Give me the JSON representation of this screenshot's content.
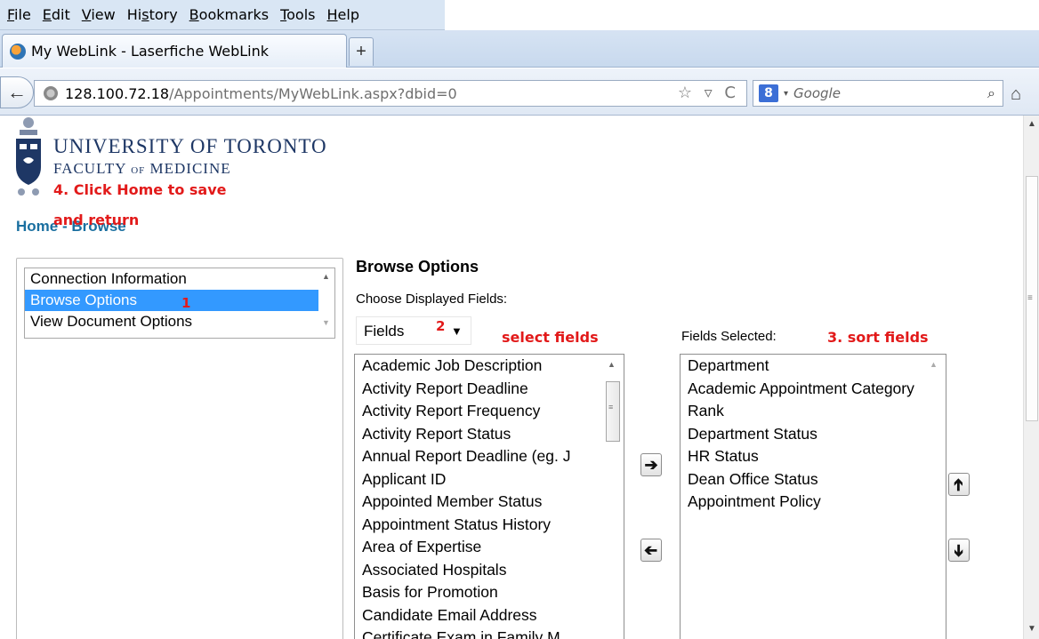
{
  "browser": {
    "menu": [
      {
        "pre": "",
        "key": "F",
        "post": "ile"
      },
      {
        "pre": "",
        "key": "E",
        "post": "dit"
      },
      {
        "pre": "",
        "key": "V",
        "post": "iew"
      },
      {
        "pre": "Hi",
        "key": "s",
        "post": "tory"
      },
      {
        "pre": "",
        "key": "B",
        "post": "ookmarks"
      },
      {
        "pre": "",
        "key": "T",
        "post": "ools"
      },
      {
        "pre": "",
        "key": "H",
        "post": "elp"
      }
    ],
    "tab_title": "My WebLink - Laserfiche WebLink",
    "new_tab": "+",
    "url_host": "128.100.72.18",
    "url_path": "/Appointments/MyWebLink.aspx?dbid=0",
    "url_icons": "☆ ▿ C",
    "search_engine_badge": "8",
    "search_placeholder": "Google"
  },
  "header": {
    "university": "UNIVERSITY OF TORONTO",
    "faculty_a": "FACULTY ",
    "faculty_of": "OF",
    "faculty_b": " MEDICINE"
  },
  "annotations": {
    "step4_line1": "4. Click Home to save",
    "step4_line2": "and return",
    "step1": "1",
    "step2": "2",
    "select_fields": "select fields",
    "step3": "3. sort fields"
  },
  "breadcrumb": {
    "home": "Home",
    "separator": " - ",
    "browse": "Browse"
  },
  "left_menu": {
    "items": [
      "Connection Information",
      "Browse Options",
      "View Document Options"
    ],
    "selected_index": 1
  },
  "browse_options": {
    "title": "Browse Options",
    "choose_label": "Choose Displayed Fields:",
    "dropdown_value": "Fields",
    "fields_selected_label": "Fields Selected:",
    "available_fields": [
      "Academic Job Description",
      "Activity Report Deadline",
      "Activity Report Frequency",
      "Activity Report Status",
      "Annual Report Deadline (eg. J",
      "Applicant ID",
      "Appointed Member Status",
      "Appointment Status History",
      "Area of Expertise",
      "Associated Hospitals",
      "Basis for Promotion",
      "Candidate Email Address",
      "Certificate Exam in Family M"
    ],
    "selected_fields": [
      "Department",
      "Academic Appointment Category",
      "Rank",
      "Department Status",
      "HR Status",
      "Dean Office Status",
      "Appointment Policy"
    ]
  }
}
